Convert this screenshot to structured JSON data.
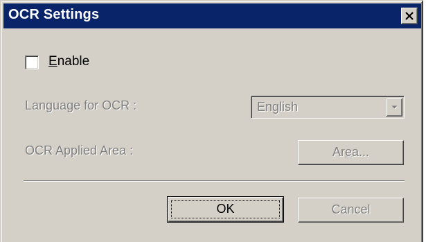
{
  "window": {
    "title": "OCR Settings",
    "close_icon": "close-icon",
    "titlebar_color": "#0a246a"
  },
  "enable_option": {
    "label_first": "E",
    "label_rest": "nable",
    "checked": false
  },
  "language": {
    "label": "Language for OCR :",
    "selected_value": "English",
    "enabled": false
  },
  "area": {
    "label": "OCR Applied Area :",
    "button_label_pre": "Ar",
    "button_label_u": "e",
    "button_label_post": "a...",
    "enabled": false
  },
  "footer": {
    "ok_label": "OK",
    "cancel_label": "Cancel",
    "cancel_enabled": false
  }
}
